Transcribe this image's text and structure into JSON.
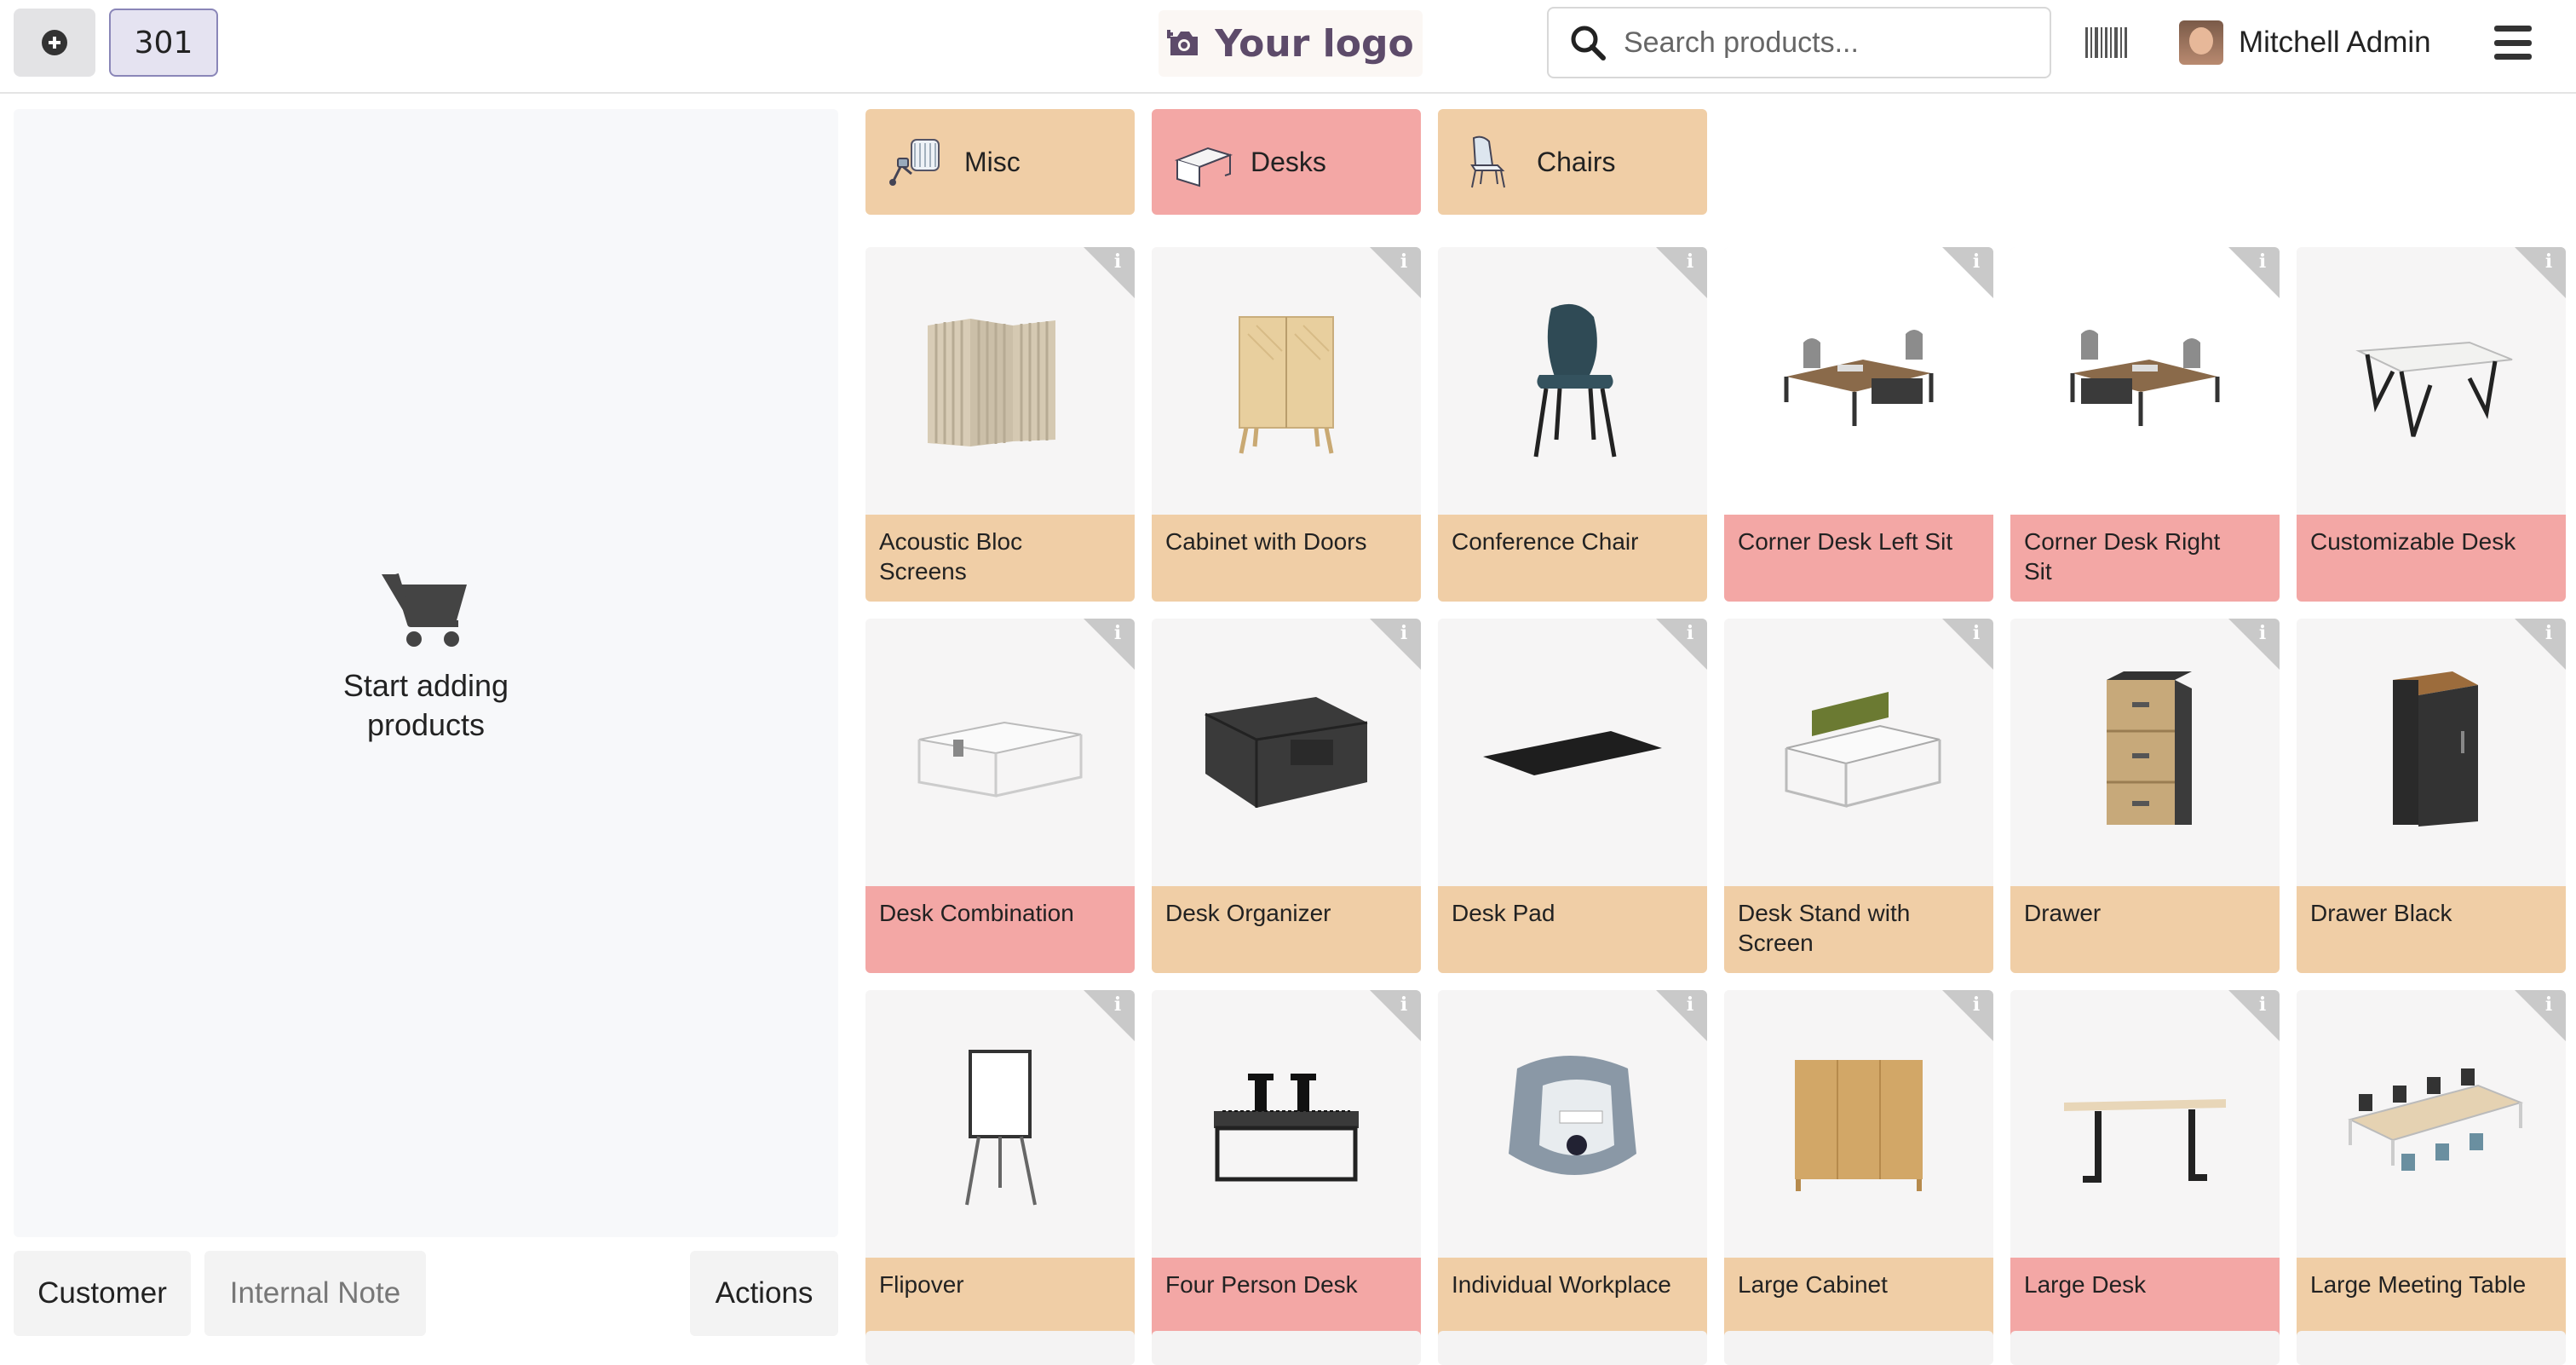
{
  "topbar": {
    "order_number": "301",
    "logo_text": "Your logo",
    "search_placeholder": "Search products...",
    "user_name": "Mitchell Admin"
  },
  "order_panel": {
    "empty_line1": "Start adding",
    "empty_line2": "products",
    "customer_label": "Customer",
    "note_label": "Internal Note",
    "actions_label": "Actions"
  },
  "categories": [
    {
      "label": "Misc",
      "color": "#f0cea6"
    },
    {
      "label": "Desks",
      "color": "#f3a7a5"
    },
    {
      "label": "Chairs",
      "color": "#f0cea6"
    }
  ],
  "products": [
    {
      "name_l1": "Acoustic Bloc",
      "name_l2": "Screens",
      "tag": "orange",
      "icon": "screens-image"
    },
    {
      "name_l1": "Cabinet with Doors",
      "name_l2": "",
      "tag": "orange",
      "icon": "cabinet-image"
    },
    {
      "name_l1": "Conference Chair",
      "name_l2": "",
      "tag": "orange",
      "icon": "chair-image"
    },
    {
      "name_l1": "Corner Desk Left Sit",
      "name_l2": "",
      "tag": "pink",
      "icon": "corner-desk-image"
    },
    {
      "name_l1": "Corner Desk Right",
      "name_l2": "Sit",
      "tag": "pink",
      "icon": "corner-desk-image"
    },
    {
      "name_l1": "Customizable Desk",
      "name_l2": "",
      "tag": "pink",
      "icon": "desk-image"
    },
    {
      "name_l1": "Desk Combination",
      "name_l2": "",
      "tag": "pink",
      "icon": "desk-combination-image"
    },
    {
      "name_l1": "Desk Organizer",
      "name_l2": "",
      "tag": "orange",
      "icon": "organizer-image"
    },
    {
      "name_l1": "Desk Pad",
      "name_l2": "",
      "tag": "orange",
      "icon": "desk-pad-image"
    },
    {
      "name_l1": "Desk Stand with",
      "name_l2": "Screen",
      "tag": "orange",
      "icon": "desk-stand-image"
    },
    {
      "name_l1": "Drawer",
      "name_l2": "",
      "tag": "orange",
      "icon": "drawer-image"
    },
    {
      "name_l1": "Drawer Black",
      "name_l2": "",
      "tag": "orange",
      "icon": "drawer-black-image"
    },
    {
      "name_l1": "Flipover",
      "name_l2": "",
      "tag": "orange",
      "icon": "flipover-image"
    },
    {
      "name_l1": "Four Person Desk",
      "name_l2": "",
      "tag": "pink",
      "icon": "four-person-desk-image"
    },
    {
      "name_l1": "Individual Workplace",
      "name_l2": "",
      "tag": "orange",
      "icon": "workplace-image"
    },
    {
      "name_l1": "Large Cabinet",
      "name_l2": "",
      "tag": "orange",
      "icon": "large-cabinet-image"
    },
    {
      "name_l1": "Large Desk",
      "name_l2": "",
      "tag": "pink",
      "icon": "large-desk-image"
    },
    {
      "name_l1": "Large Meeting Table",
      "name_l2": "",
      "tag": "orange",
      "icon": "meeting-table-image"
    }
  ]
}
